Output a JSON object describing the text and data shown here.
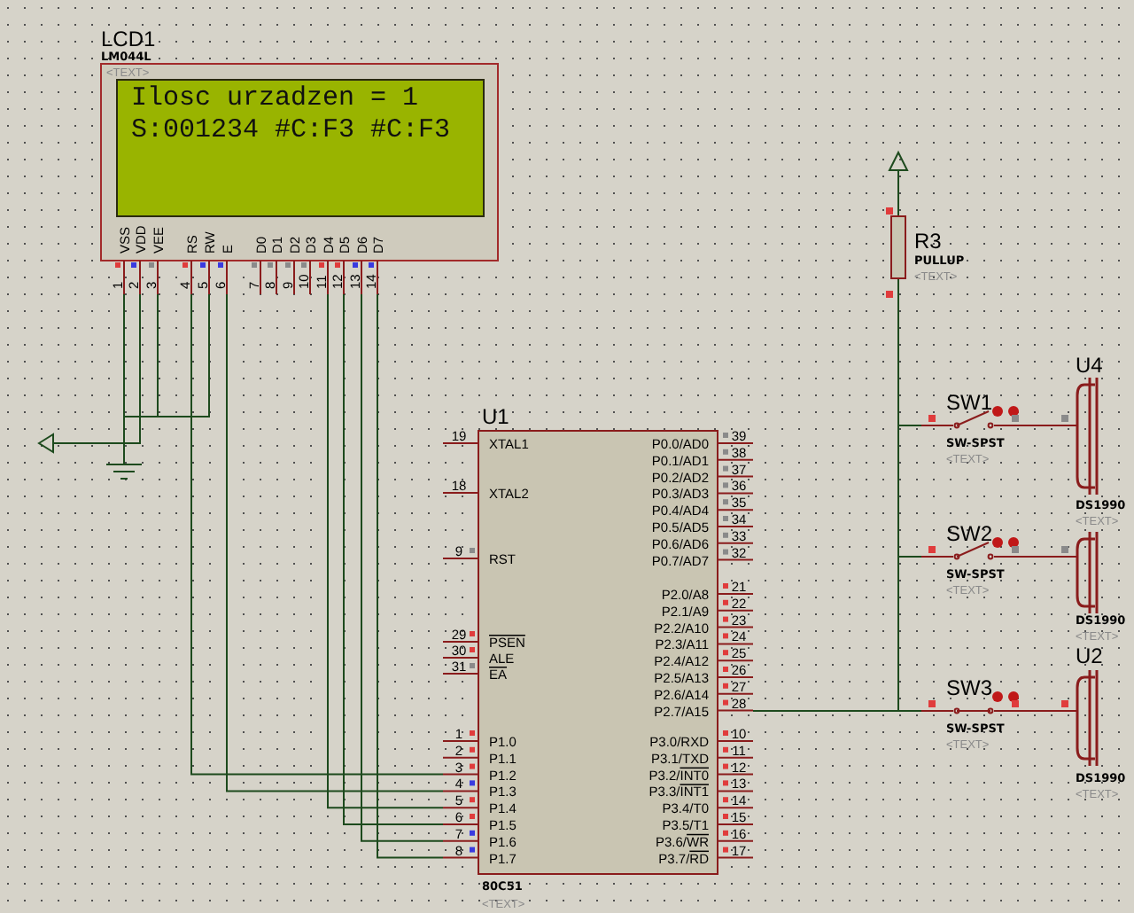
{
  "lcd": {
    "reference": "LCD1",
    "part": "LM044L",
    "text_label": "<TEXT>",
    "lines": [
      "Ilosc urzadzen = 1",
      "S:001234 #C:F3 #C:F3"
    ],
    "pins": [
      {
        "label": "VSS",
        "number": "1",
        "color": "#e03c3c"
      },
      {
        "label": "VDD",
        "number": "2",
        "color": "#3a3ae0"
      },
      {
        "label": "VEE",
        "number": "3",
        "color": "#8a8a8a"
      },
      {
        "label": "RS",
        "number": "4",
        "color": "#e03c3c"
      },
      {
        "label": "RW",
        "number": "5",
        "color": "#3a3ae0"
      },
      {
        "label": "E",
        "number": "6",
        "color": "#3a3ae0"
      },
      {
        "label": "D0",
        "number": "7",
        "color": "#8a8a8a"
      },
      {
        "label": "D1",
        "number": "8",
        "color": "#8a8a8a"
      },
      {
        "label": "D2",
        "number": "9",
        "color": "#8a8a8a"
      },
      {
        "label": "D3",
        "number": "10",
        "color": "#8a8a8a"
      },
      {
        "label": "D4",
        "number": "11",
        "color": "#e03c3c"
      },
      {
        "label": "D5",
        "number": "12",
        "color": "#e03c3c"
      },
      {
        "label": "D6",
        "number": "13",
        "color": "#3a3ae0"
      },
      {
        "label": "D7",
        "number": "14",
        "color": "#3a3ae0"
      }
    ]
  },
  "mcu": {
    "reference": "U1",
    "part": "80C51",
    "text_label": "<TEXT>",
    "left_pins": [
      {
        "label": "XTAL1",
        "number": "19",
        "inverted": false
      },
      {
        "label": "XTAL2",
        "number": "18",
        "inverted": false
      },
      {
        "label": "RST",
        "number": "9",
        "color": "#8a8a8a",
        "inverted": false
      },
      {
        "label": "PSEN",
        "number": "29",
        "color": "#e03c3c",
        "inverted": true
      },
      {
        "label": "ALE",
        "number": "30",
        "color": "#e03c3c",
        "inverted": false
      },
      {
        "label": "EA",
        "number": "31",
        "color": "#8a8a8a",
        "inverted": true
      },
      {
        "label": "P1.0",
        "number": "1",
        "color": "#e03c3c",
        "inverted": false
      },
      {
        "label": "P1.1",
        "number": "2",
        "color": "#e03c3c",
        "inverted": false
      },
      {
        "label": "P1.2",
        "number": "3",
        "color": "#e03c3c",
        "inverted": false
      },
      {
        "label": "P1.3",
        "number": "4",
        "color": "#3a3ae0",
        "inverted": false
      },
      {
        "label": "P1.4",
        "number": "5",
        "color": "#e03c3c",
        "inverted": false
      },
      {
        "label": "P1.5",
        "number": "6",
        "color": "#e03c3c",
        "inverted": false
      },
      {
        "label": "P1.6",
        "number": "7",
        "color": "#3a3ae0",
        "inverted": false
      },
      {
        "label": "P1.7",
        "number": "8",
        "color": "#3a3ae0",
        "inverted": false
      }
    ],
    "right_pins": [
      {
        "label": "P0.0/AD0",
        "number": "39",
        "color": "#8a8a8a",
        "inverted": false
      },
      {
        "label": "P0.1/AD1",
        "number": "38",
        "color": "#8a8a8a",
        "inverted": false
      },
      {
        "label": "P0.2/AD2",
        "number": "37",
        "color": "#8a8a8a",
        "inverted": false
      },
      {
        "label": "P0.3/AD3",
        "number": "36",
        "color": "#8a8a8a",
        "inverted": false
      },
      {
        "label": "P0.4/AD4",
        "number": "35",
        "color": "#8a8a8a",
        "inverted": false
      },
      {
        "label": "P0.5/AD5",
        "number": "34",
        "color": "#8a8a8a",
        "inverted": false
      },
      {
        "label": "P0.6/AD6",
        "number": "33",
        "color": "#8a8a8a",
        "inverted": false
      },
      {
        "label": "P0.7/AD7",
        "number": "32",
        "color": "#8a8a8a",
        "inverted": false
      },
      {
        "label": "P2.0/A8",
        "number": "21",
        "color": "#e03c3c",
        "inverted": false
      },
      {
        "label": "P2.1/A9",
        "number": "22",
        "color": "#e03c3c",
        "inverted": false
      },
      {
        "label": "P2.2/A10",
        "number": "23",
        "color": "#e03c3c",
        "inverted": false
      },
      {
        "label": "P2.3/A11",
        "number": "24",
        "color": "#e03c3c",
        "inverted": false
      },
      {
        "label": "P2.4/A12",
        "number": "25",
        "color": "#e03c3c",
        "inverted": false
      },
      {
        "label": "P2.5/A13",
        "number": "26",
        "color": "#e03c3c",
        "inverted": false
      },
      {
        "label": "P2.6/A14",
        "number": "27",
        "color": "#e03c3c",
        "inverted": false
      },
      {
        "label": "P2.7/A15",
        "number": "28",
        "color": "#e03c3c",
        "inverted": false
      },
      {
        "label": "P3.0/RXD",
        "number": "10",
        "color": "#e03c3c",
        "inverted": false
      },
      {
        "label": "P3.1/TXD",
        "number": "11",
        "color": "#e03c3c",
        "inverted": false
      },
      {
        "label": "P3.2/INT0",
        "number": "12",
        "color": "#e03c3c",
        "inverted": true
      },
      {
        "label": "P3.3/INT1",
        "number": "13",
        "color": "#e03c3c",
        "inverted": true
      },
      {
        "label": "P3.4/T0",
        "number": "14",
        "color": "#e03c3c",
        "inverted": false
      },
      {
        "label": "P3.5/T1",
        "number": "15",
        "color": "#e03c3c",
        "inverted": false
      },
      {
        "label": "P3.6/WR",
        "number": "16",
        "color": "#e03c3c",
        "inverted": true
      },
      {
        "label": "P3.7/RD",
        "number": "17",
        "color": "#e03c3c",
        "inverted": true
      }
    ]
  },
  "resistor": {
    "reference": "R3",
    "value": "PULLUP",
    "text_label": "<TEXT>",
    "pins": [
      {
        "color": "#e03c3c"
      },
      {
        "color": "#e03c3c"
      }
    ]
  },
  "switches": [
    {
      "reference": "SW1",
      "part": "SW-SPST",
      "text_label": "<TEXT>",
      "closed": false,
      "pins": [
        {
          "color": "#e03c3c"
        },
        {
          "color": "#8a8a8a"
        },
        {
          "color": "#8a8a8a"
        }
      ]
    },
    {
      "reference": "SW2",
      "part": "SW-SPST",
      "text_label": "<TEXT>",
      "closed": false,
      "pins": [
        {
          "color": "#e03c3c"
        },
        {
          "color": "#8a8a8a"
        },
        {
          "color": "#8a8a8a"
        }
      ]
    },
    {
      "reference": "SW3",
      "part": "SW-SPST",
      "text_label": "<TEXT>",
      "closed": true,
      "pins": [
        {
          "color": "#e03c3c"
        },
        {
          "color": "#e03c3c"
        },
        {
          "color": "#e03c3c"
        }
      ]
    }
  ],
  "ibuttons": [
    {
      "reference": "U4",
      "part": "DS1990",
      "text_label": "<TEXT>"
    },
    {
      "part": "DS1990",
      "text_label": "<TEXT>"
    },
    {
      "reference": "U2",
      "part": "DS1990",
      "text_label": "<TEXT>"
    }
  ]
}
